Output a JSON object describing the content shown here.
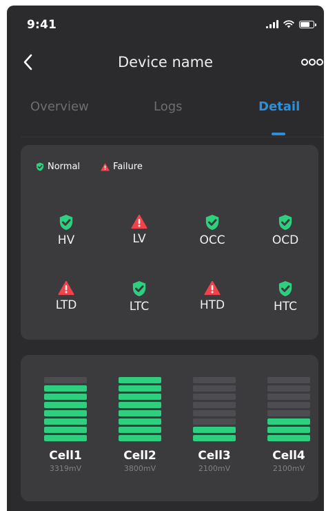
{
  "status_bar": {
    "time": "9:41"
  },
  "nav": {
    "title": "Device name"
  },
  "tabs": [
    {
      "label": "Overview",
      "active": false
    },
    {
      "label": "Logs",
      "active": false
    },
    {
      "label": "Detail",
      "active": true
    }
  ],
  "legend": [
    {
      "label": "Normal",
      "icon": "shield-check-icon",
      "color": "#2ed07f"
    },
    {
      "label": "Failure",
      "icon": "warning-triangle-icon",
      "color": "#f0434b"
    }
  ],
  "protections": [
    {
      "label": "HV",
      "status": "normal"
    },
    {
      "label": "LV",
      "status": "failure"
    },
    {
      "label": "OCC",
      "status": "normal"
    },
    {
      "label": "OCD",
      "status": "normal"
    },
    {
      "label": "LTD",
      "status": "failure"
    },
    {
      "label": "LTC",
      "status": "normal"
    },
    {
      "label": "HTD",
      "status": "failure"
    },
    {
      "label": "HTC",
      "status": "normal"
    }
  ],
  "cells": [
    {
      "name": "Cell1",
      "voltage": "3319mV",
      "level_segments": 7,
      "total_segments": 8
    },
    {
      "name": "Cell2",
      "voltage": "3800mV",
      "level_segments": 8,
      "total_segments": 8
    },
    {
      "name": "Cell3",
      "voltage": "2100mV",
      "level_segments": 2,
      "total_segments": 8
    },
    {
      "name": "Cell4",
      "voltage": "2100mV",
      "level_segments": 3,
      "total_segments": 8
    }
  ],
  "colors": {
    "background": "#2b2b2d",
    "card": "#3b3b3e",
    "accent": "#2c8fd8",
    "normal": "#2ed07f",
    "failure": "#f0434b",
    "bar_empty": "#4d4d51"
  }
}
